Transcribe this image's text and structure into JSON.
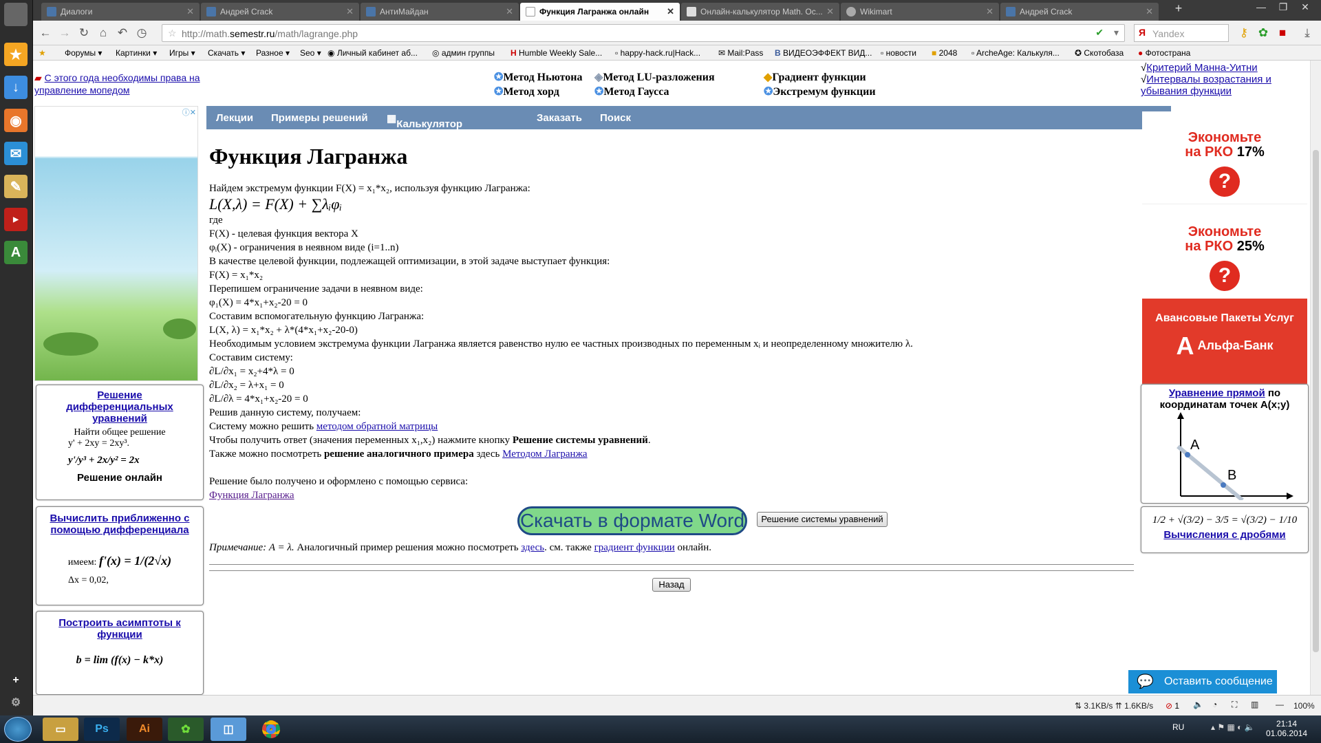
{
  "tabs": [
    {
      "label": "Диалоги"
    },
    {
      "label": "Андрей Crack"
    },
    {
      "label": "АнтиМайдан"
    },
    {
      "label": "Функция Лагранжа онлайн"
    },
    {
      "label": "Онлайн-калькулятор Math. Ос..."
    },
    {
      "label": "Wikimart"
    },
    {
      "label": "Андрей Crack"
    }
  ],
  "address": {
    "prefix": "http://math.",
    "domain": "semestr.ru",
    "path": "/math/lagrange.php",
    "search_placeholder": "Yandex"
  },
  "bookmarks": [
    "Форумы",
    "Картинки",
    "Игры",
    "Скачать",
    "Разное",
    "Seo",
    "Личный кабинет аб...",
    "админ группы",
    "Humble Weekly Sale...",
    "happy-hack.ru|Hack...",
    "Mail:Pass",
    "ВИДЕОЭФФЕКТ ВИД...",
    "новости",
    "2048",
    "ArcheAge: Калькуля...",
    "Скотобаза",
    "Фотострана"
  ],
  "left_col": {
    "notice": "С этого года необходимы права на управление мопедом",
    "box1": {
      "title": "Решение дифференциальных уравнений",
      "line1": "Найти общее решение",
      "line2": "y' + 2xy = 2xy³.",
      "formula": "y'/y³ + 2x/y² = 2x",
      "footer": "Решение онлайн"
    },
    "box2": {
      "title": "Вычислить приближенно с помощью дифференциала",
      "formula_prefix": "имеем:",
      "formula": "f'(x) = 1/(2√x)",
      "line": "Δx = 0,02,"
    },
    "box3": {
      "title": "Построить асимптоты к функции",
      "formula": "b = lim (f(x) − k*x)"
    }
  },
  "top_links": [
    {
      "label": "Метод Ньютона"
    },
    {
      "label": "Метод LU-разложения"
    },
    {
      "label": "Градиент функции"
    },
    {
      "label": "Метод хорд"
    },
    {
      "label": "Метод Гаусса"
    },
    {
      "label": "Экстремум функции"
    }
  ],
  "menu": [
    "Лекции",
    "Примеры решений",
    "Калькулятор по математике",
    "Заказать",
    "Поиск"
  ],
  "content": {
    "title": "Функция Лагранжа",
    "intro": "Найдем экстремум функции F(X) = x₁*x₂, используя функцию Лагранжа:",
    "formula": "L(X,λ) = F(X) + ∑λᵢφᵢ",
    "where": "где",
    "def1": "F(X) - целевая функция вектора X",
    "def2": "φᵢ(X) - ограничения в неявном виде (i=1..n)",
    "p1": "В качестве целевой функции, подлежащей оптимизации, в этой задаче выступает функция:",
    "f1": "F(X) = x₁*x₂",
    "p2": "Перепишем ограничение задачи в неявном виде:",
    "f2": "φ₁(X) = 4*x₁+x₂-20 = 0",
    "p3": "Составим вспомогательную функцию Лагранжа:",
    "f3": "L(X, λ) = x₁*x₂ + λ*(4*x₁+x₂-20-0)",
    "p4": "Необходимым условием экстремума функции Лагранжа является равенство нулю ее частных производных по переменным xᵢ и неопределенному множителю λ.",
    "p5": "Составим систему:",
    "e1": "∂L/∂x₁ = x₂+4*λ = 0",
    "e2": "∂L/∂x₂ = λ+x₁ = 0",
    "e3": "∂L/∂λ = 4*x₁+x₂-20 = 0",
    "p6": "Решив данную систему, получаем:",
    "p7_text": "Систему можно решить ",
    "p7_link": "методом обратной матрицы",
    "p8_text": "Чтобы получить ответ (значения переменных x₁,x₂) нажмите кнопку ",
    "p8_bold": "Решение системы уравнений",
    "p9_text": "Также можно посмотреть ",
    "p9_bold": "решение аналогичного примера",
    "p9_mid": " здесь ",
    "p9_link": "Методом Лагранжа",
    "p10": "Решение было получено и оформлено с помощью сервиса:",
    "p10_link": "Функция Лагранжа",
    "word_button": "Скачать в формате Word",
    "solve_button": "Решение системы уравнений",
    "note_italic": "Примечание: A = λ.",
    "note_text": " Аналогичный пример решения можно посмотреть ",
    "note_link1": "здесь",
    "note_mid": ". см. также ",
    "note_link2": "градиент функции",
    "note_end": " онлайн.",
    "back_button": "Назад"
  },
  "right_col": {
    "link1": "Критерий Манна-Уитни",
    "link2": "Интервалы возрастания и убывания функции",
    "ad1": {
      "line1": "Экономьте",
      "line2": "на РКО",
      "pct": "17%"
    },
    "ad2": {
      "line1": "Экономьте",
      "line2": "на РКО",
      "pct": "25%"
    },
    "ad3": {
      "line1": "Авансовые Пакеты Услуг",
      "bank": "Альфа-Банк",
      "logo": "А"
    },
    "box1": {
      "link": "Уравнение прямой",
      "rest": " по координатам точек A(x;y)",
      "pointA": "A",
      "pointB": "B"
    },
    "box2": {
      "formula": "1/2 + √(3/2) − 3/5 = √(3/2) − 1/10",
      "link": "Вычисления с дробями"
    }
  },
  "chat_button": "Оставить сообщение",
  "status": {
    "down": "3.1KB/s",
    "up": "1.6KB/s",
    "count": "1",
    "zoom": "100%"
  },
  "taskbar": {
    "lang": "RU",
    "time": "21:14",
    "date": "01.06.2014"
  }
}
